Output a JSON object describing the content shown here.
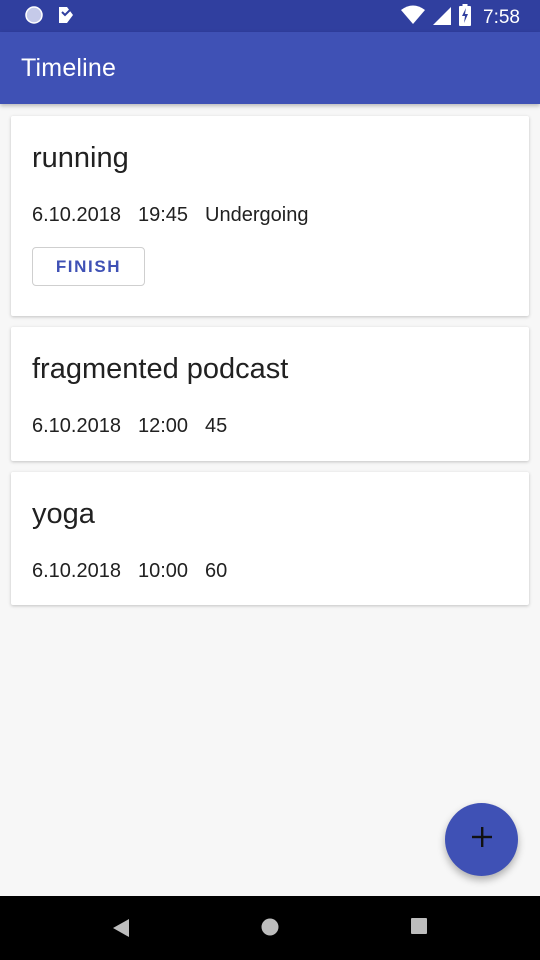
{
  "status_bar": {
    "time": "7:58",
    "icons": [
      "notification-circle-icon",
      "notification-tag-icon",
      "wifi-icon",
      "cell-signal-icon",
      "battery-charging-icon"
    ]
  },
  "app_bar": {
    "title": "Timeline"
  },
  "cards": [
    {
      "title": "running",
      "date": "6.10.2018",
      "time": "19:45",
      "detail": "Undergoing",
      "action_label": "FINISH"
    },
    {
      "title": "fragmented podcast",
      "date": "6.10.2018",
      "time": "12:00",
      "detail": "45"
    },
    {
      "title": "yoga",
      "date": "6.10.2018",
      "time": "10:00",
      "detail": "60"
    }
  ],
  "fab": {
    "icon": "plus-icon"
  },
  "nav_bar": {
    "icons": [
      "back-icon",
      "home-icon",
      "recents-icon"
    ]
  },
  "colors": {
    "primary": "#3f51b5",
    "primary_dark": "#303f9f",
    "background": "#f7f7f7",
    "text": "#212121"
  }
}
